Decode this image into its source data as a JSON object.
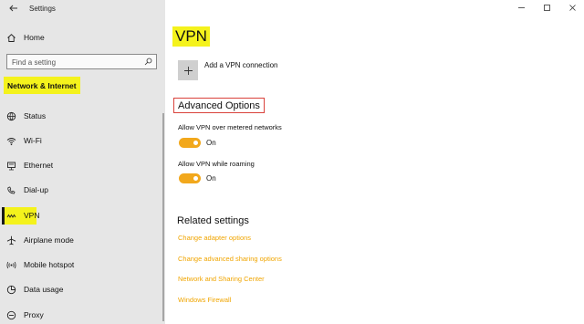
{
  "window": {
    "title": "Settings"
  },
  "sidebar": {
    "home": {
      "label": "Home",
      "icon": "home-icon"
    },
    "search": {
      "placeholder": "Find a setting"
    },
    "section_heading": "Network & Internet",
    "items": [
      {
        "label": "Status",
        "icon": "globe-icon"
      },
      {
        "label": "Wi-Fi",
        "icon": "wifi-icon"
      },
      {
        "label": "Ethernet",
        "icon": "ethernet-icon"
      },
      {
        "label": "Dial-up",
        "icon": "dialup-icon"
      },
      {
        "label": "VPN",
        "icon": "vpn-icon",
        "selected": true
      },
      {
        "label": "Airplane mode",
        "icon": "airplane-icon"
      },
      {
        "label": "Mobile hotspot",
        "icon": "hotspot-icon"
      },
      {
        "label": "Data usage",
        "icon": "data-usage-icon"
      },
      {
        "label": "Proxy",
        "icon": "proxy-icon"
      }
    ]
  },
  "main": {
    "title": "VPN",
    "add_vpn_label": "Add a VPN connection",
    "advanced_heading": "Advanced Options",
    "settings": [
      {
        "label": "Allow VPN over metered networks",
        "state": "On",
        "enabled": true
      },
      {
        "label": "Allow VPN while roaming",
        "state": "On",
        "enabled": true
      }
    ],
    "related_heading": "Related settings",
    "related_links": [
      "Change adapter options",
      "Change advanced sharing options",
      "Network and Sharing Center",
      "Windows Firewall"
    ]
  },
  "colors": {
    "highlight": "#f4f21c",
    "accent": "#f2a81c",
    "link": "#f0a500",
    "red_box": "#d9423c",
    "sidebar_bg": "#e6e6e6"
  }
}
